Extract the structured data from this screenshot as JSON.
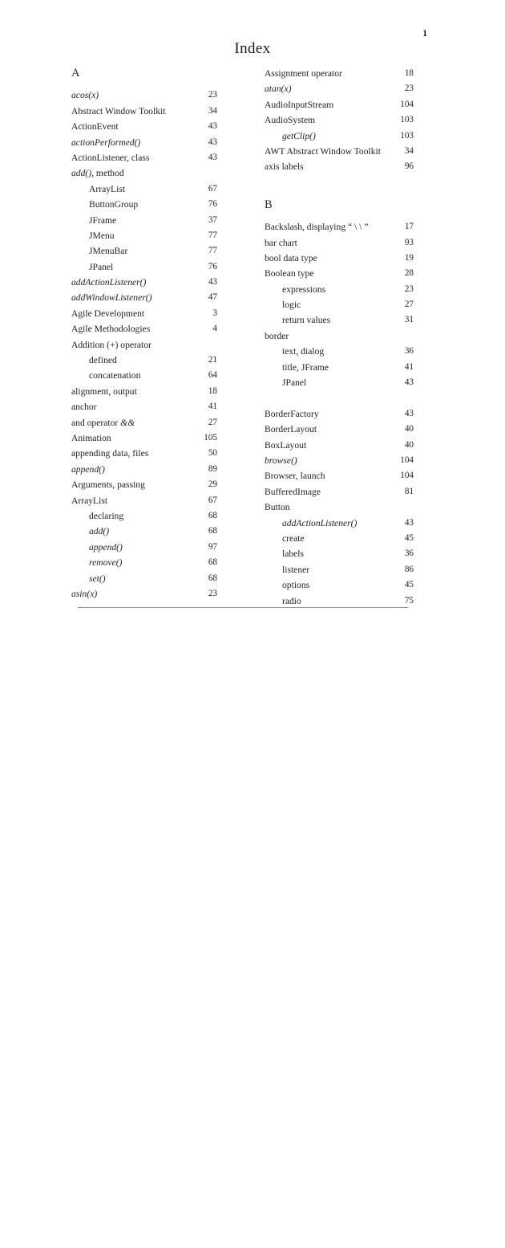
{
  "page": {
    "number": "1",
    "title": "Index",
    "rule_color": "#8f9b58"
  },
  "columns": {
    "left": {
      "section_letter": "A",
      "entries": [
        {
          "term": "acos(x)",
          "page": "23",
          "italic": true,
          "indent": false
        },
        {
          "term": "Abstract Window Toolkit",
          "page": "34",
          "italic": false,
          "indent": false
        },
        {
          "term": "ActionEvent",
          "page": "43",
          "italic": false,
          "indent": false
        },
        {
          "term": "actionPerformed()",
          "page": "43",
          "italic": true,
          "indent": false
        },
        {
          "term": "ActionListener, class",
          "page": "43",
          "italic": false,
          "indent": false
        },
        {
          "term": "add(), method",
          "page": "",
          "italic": false,
          "indent": false,
          "italic_prefix": "add()"
        },
        {
          "term": "ArrayList",
          "page": "67",
          "italic": false,
          "indent": true
        },
        {
          "term": "ButtonGroup",
          "page": "76",
          "italic": false,
          "indent": true
        },
        {
          "term": "JFrame",
          "page": "37",
          "italic": false,
          "indent": true
        },
        {
          "term": "JMenu",
          "page": "77",
          "italic": false,
          "indent": true
        },
        {
          "term": "JMenuBar",
          "page": "77",
          "italic": false,
          "indent": true
        },
        {
          "term": "JPanel",
          "page": "76",
          "italic": false,
          "indent": true
        },
        {
          "term": "addActionListener()",
          "page": "43",
          "italic": true,
          "indent": false
        },
        {
          "term": "addWindowListener()",
          "page": "47",
          "italic": true,
          "indent": false
        },
        {
          "term": "Agile Development",
          "page": "3",
          "italic": false,
          "indent": false
        },
        {
          "term": "Agile Methodologies",
          "page": "4",
          "italic": false,
          "indent": false
        },
        {
          "term": "Addition (+) operator",
          "page": "",
          "italic": false,
          "indent": false
        },
        {
          "term": "defined",
          "page": "21",
          "italic": false,
          "indent": true
        },
        {
          "term": "concatenation",
          "page": "64",
          "italic": false,
          "indent": true
        },
        {
          "term": "alignment, output",
          "page": "18",
          "italic": false,
          "indent": false
        },
        {
          "term": "anchor",
          "page": "41",
          "italic": false,
          "indent": false
        },
        {
          "term": "and operator &&",
          "page": "27",
          "italic": false,
          "indent": false,
          "italic_suffix": "&&"
        },
        {
          "term": "Animation",
          "page": "105",
          "italic": false,
          "indent": false
        },
        {
          "term": "appending data, files",
          "page": "50",
          "italic": false,
          "indent": false
        },
        {
          "term": "append()",
          "page": "89",
          "italic": true,
          "indent": false
        },
        {
          "term": "Arguments, passing",
          "page": "29",
          "italic": false,
          "indent": false
        },
        {
          "term": "ArrayList",
          "page": "67",
          "italic": false,
          "indent": false
        },
        {
          "term": "declaring",
          "page": "68",
          "italic": false,
          "indent": true
        },
        {
          "term": "add()",
          "page": "68",
          "italic": true,
          "indent": true
        },
        {
          "term": "append()",
          "page": "97",
          "italic": true,
          "indent": true
        },
        {
          "term": "remove()",
          "page": "68",
          "italic": true,
          "indent": true
        },
        {
          "term": "set()",
          "page": "68",
          "italic": true,
          "indent": true
        },
        {
          "term": "asin(x)",
          "page": "23",
          "italic": true,
          "indent": false
        }
      ]
    },
    "right": {
      "entries_before_letter": [
        {
          "term": "Assignment operator",
          "page": "18",
          "italic": false,
          "indent": false
        },
        {
          "term": "atan(x)",
          "page": "23",
          "italic": true,
          "indent": false
        },
        {
          "term": "AudioInputStream",
          "page": "104",
          "italic": false,
          "indent": false
        },
        {
          "term": "AudioSystem",
          "page": "103",
          "italic": false,
          "indent": false
        },
        {
          "term": "getClip()",
          "page": "103",
          "italic": true,
          "indent": true
        },
        {
          "term": "AWT Abstract Window Toolkit",
          "page": "34",
          "italic": false,
          "indent": false
        },
        {
          "term": "axis labels",
          "page": "96",
          "italic": false,
          "indent": false
        }
      ],
      "section_letter": "B",
      "entries": [
        {
          "term": "Backslash, displaying “ \\ \\ ”",
          "page": "17",
          "italic": false,
          "indent": false
        },
        {
          "term": "bar chart",
          "page": "93",
          "italic": false,
          "indent": false
        },
        {
          "term": "bool data type",
          "page": "19",
          "italic": false,
          "indent": false
        },
        {
          "term": "Boolean type",
          "page": "28",
          "italic": false,
          "indent": false
        },
        {
          "term": "expressions",
          "page": "23",
          "italic": false,
          "indent": true
        },
        {
          "term": "logic",
          "page": "27",
          "italic": false,
          "indent": true
        },
        {
          "term": "return values",
          "page": "31",
          "italic": false,
          "indent": true
        },
        {
          "term": "border",
          "page": "",
          "italic": false,
          "indent": false
        },
        {
          "term": "text, dialog",
          "page": "36",
          "italic": false,
          "indent": true
        },
        {
          "term": "title, JFrame",
          "page": "41",
          "italic": false,
          "indent": true
        },
        {
          "term": "JPanel",
          "page": "43",
          "italic": false,
          "indent": true
        },
        {
          "term": "",
          "page": "",
          "italic": false,
          "indent": false,
          "spacer": true
        },
        {
          "term": "BorderFactory",
          "page": "43",
          "italic": false,
          "indent": false
        },
        {
          "term": "BorderLayout",
          "page": "40",
          "italic": false,
          "indent": false
        },
        {
          "term": "BoxLayout",
          "page": "40",
          "italic": false,
          "indent": false
        },
        {
          "term": "browse()",
          "page": "104",
          "italic": true,
          "indent": false
        },
        {
          "term": "Browser, launch",
          "page": "104",
          "italic": false,
          "indent": false
        },
        {
          "term": "BufferedImage",
          "page": "81",
          "italic": false,
          "indent": false
        },
        {
          "term": "Button",
          "page": "",
          "italic": false,
          "indent": false
        },
        {
          "term": "addActionListener()",
          "page": "43",
          "italic": true,
          "indent": true
        },
        {
          "term": "create",
          "page": "45",
          "italic": false,
          "indent": true
        },
        {
          "term": "labels",
          "page": "36",
          "italic": false,
          "indent": true
        },
        {
          "term": "listener",
          "page": "86",
          "italic": false,
          "indent": true
        },
        {
          "term": "options",
          "page": "45",
          "italic": false,
          "indent": true
        },
        {
          "term": "radio",
          "page": "75",
          "italic": false,
          "indent": true
        }
      ]
    }
  }
}
